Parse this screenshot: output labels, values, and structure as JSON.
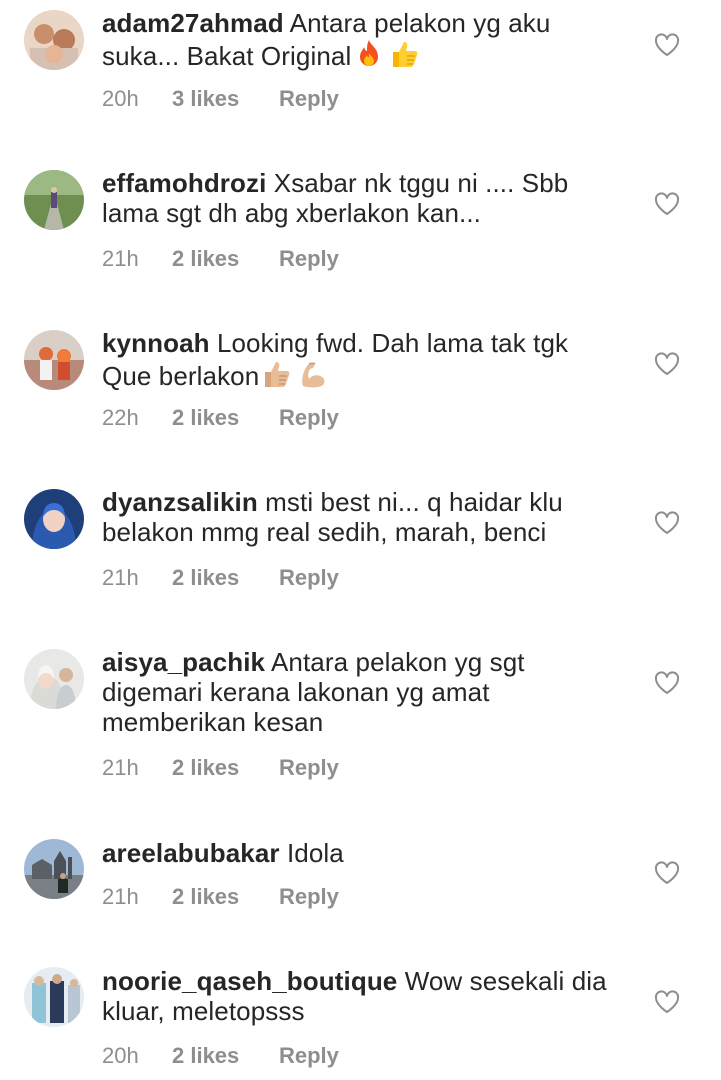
{
  "comments": [
    {
      "username": "adam27ahmad",
      "text": "Antara pelakon yg aku suka... Bakat Original",
      "emojis": [
        "fire",
        "thumbs-up"
      ],
      "time": "20h",
      "likes": "3 likes",
      "reply": "Reply"
    },
    {
      "username": "effamohdrozi",
      "text": "Xsabar nk tggu ni .... Sbb lama sgt dh abg xberlakon kan...",
      "emojis": [],
      "time": "21h",
      "likes": "2 likes",
      "reply": "Reply"
    },
    {
      "username": "kynnoah",
      "text": "Looking fwd. Dah lama tak tgk Que berlakon",
      "emojis": [
        "thumbs-up",
        "flexed-biceps"
      ],
      "time": "22h",
      "likes": "2 likes",
      "reply": "Reply"
    },
    {
      "username": "dyanzsalikin",
      "text": "msti best ni... q haidar klu belakon mmg real sedih, marah, benci",
      "emojis": [],
      "time": "21h",
      "likes": "2 likes",
      "reply": "Reply"
    },
    {
      "username": "aisya_pachik",
      "text": "Antara pelakon yg sgt digemari kerana lakonan yg amat memberikan kesan",
      "emojis": [],
      "time": "21h",
      "likes": "2 likes",
      "reply": "Reply"
    },
    {
      "username": "areelabubakar",
      "text": "Idola",
      "emojis": [],
      "time": "21h",
      "likes": "2 likes",
      "reply": "Reply"
    },
    {
      "username": "noorie_qaseh_boutique",
      "text": "Wow sesekali dia kluar, meletopsss",
      "emojis": [],
      "time": "20h",
      "likes": "2 likes",
      "reply": "Reply"
    }
  ],
  "colors": {
    "text": "#262626",
    "meta": "#8e8e8e",
    "background": "#ffffff"
  },
  "icons": {
    "like": "heart-outline-icon"
  }
}
